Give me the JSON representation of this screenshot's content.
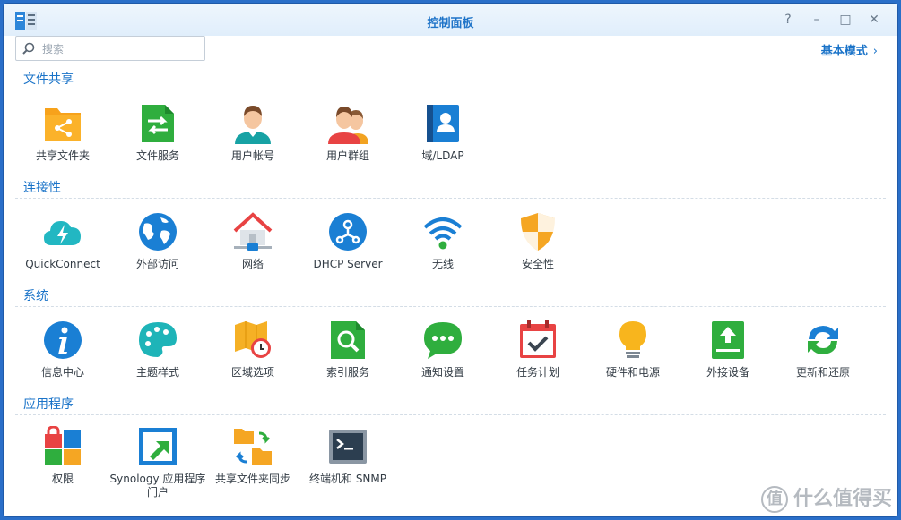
{
  "window": {
    "title": "控制面板"
  },
  "controls": {
    "help": "?",
    "minimize": "–",
    "maximize": "□",
    "close": "✕"
  },
  "search": {
    "placeholder": "搜索"
  },
  "mode_link": {
    "label": "基本模式",
    "chevron": "›"
  },
  "sections": [
    {
      "title": "文件共享",
      "items": [
        {
          "label": "共享文件夹",
          "icon": "shared-folder-icon"
        },
        {
          "label": "文件服务",
          "icon": "file-services-icon"
        },
        {
          "label": "用户帐号",
          "icon": "user-icon"
        },
        {
          "label": "用户群组",
          "icon": "group-icon"
        },
        {
          "label": "域/LDAP",
          "icon": "directory-icon"
        }
      ]
    },
    {
      "title": "连接性",
      "items": [
        {
          "label": "QuickConnect",
          "icon": "cloud-bolt-icon"
        },
        {
          "label": "外部访问",
          "icon": "globe-icon"
        },
        {
          "label": "网络",
          "icon": "network-house-icon"
        },
        {
          "label": "DHCP Server",
          "icon": "dhcp-icon"
        },
        {
          "label": "无线",
          "icon": "wifi-icon"
        },
        {
          "label": "安全性",
          "icon": "shield-icon"
        }
      ]
    },
    {
      "title": "系统",
      "items": [
        {
          "label": "信息中心",
          "icon": "info-icon"
        },
        {
          "label": "主题样式",
          "icon": "palette-icon"
        },
        {
          "label": "区域选项",
          "icon": "map-clock-icon"
        },
        {
          "label": "索引服务",
          "icon": "index-search-icon"
        },
        {
          "label": "通知设置",
          "icon": "chat-bubble-icon"
        },
        {
          "label": "任务计划",
          "icon": "calendar-check-icon"
        },
        {
          "label": "硬件和电源",
          "icon": "lightbulb-icon"
        },
        {
          "label": "外接设备",
          "icon": "external-device-icon"
        },
        {
          "label": "更新和还原",
          "icon": "refresh-icon"
        }
      ]
    },
    {
      "title": "应用程序",
      "items": [
        {
          "label": "权限",
          "icon": "privileges-grid-icon"
        },
        {
          "label": "Synology 应用程序门户",
          "icon": "portal-arrow-icon"
        },
        {
          "label": "共享文件夹同步",
          "icon": "folder-sync-icon"
        },
        {
          "label": "终端机和 SNMP",
          "icon": "terminal-icon"
        }
      ]
    }
  ],
  "watermark": {
    "zhi": "值",
    "text": "什么值得买"
  },
  "colors": {
    "accent": "#1a73c8",
    "frame": "#2a6fc9"
  }
}
